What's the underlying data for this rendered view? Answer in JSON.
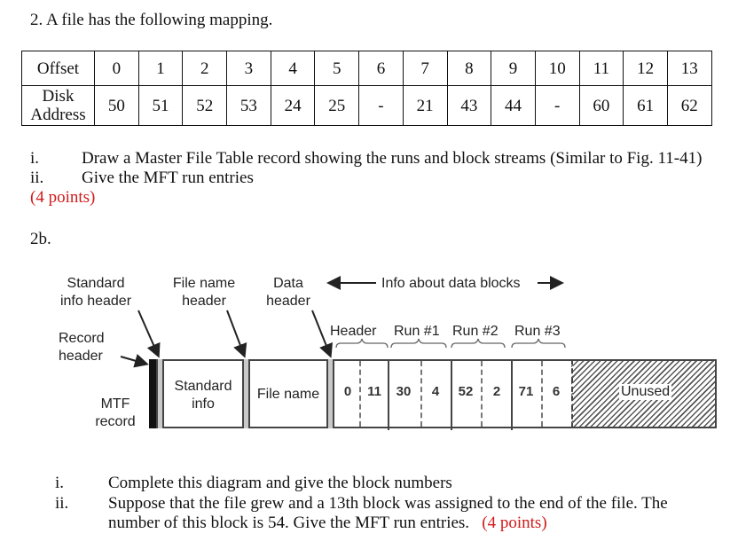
{
  "question2": {
    "title": "2.   A file has the following mapping.",
    "table": {
      "row_headers": [
        "Offset",
        "Disk Address"
      ],
      "offsets": [
        "0",
        "1",
        "2",
        "3",
        "4",
        "5",
        "6",
        "7",
        "8",
        "9",
        "10",
        "11",
        "12",
        "13"
      ],
      "disk_addresses": [
        "50",
        "51",
        "52",
        "53",
        "24",
        "25",
        "-",
        "21",
        "43",
        "44",
        "-",
        "60",
        "61",
        "62"
      ]
    },
    "items": [
      {
        "marker": "i.",
        "text": "Draw a Master File Table record showing the runs and block streams (Similar to Fig. 11-41)"
      },
      {
        "marker": "ii.",
        "text": "Give the MFT run entries"
      }
    ],
    "points": "(4 points)"
  },
  "question2b": {
    "label": "2b.",
    "diagram": {
      "labels": {
        "standard_info_header": [
          "Standard",
          "info header"
        ],
        "file_name_header": [
          "File name",
          "header"
        ],
        "data_header": [
          "Data",
          "header"
        ],
        "info_about_data_blocks": "Info about data blocks",
        "record_header": [
          "Record",
          "header"
        ],
        "mtf_record": [
          "MTF",
          "record"
        ]
      },
      "fields": {
        "standard_info": [
          "Standard",
          "info"
        ],
        "file_name": "File name",
        "unused": "Unused"
      },
      "groups": [
        "Header",
        "Run #1",
        "Run #2",
        "Run #3"
      ],
      "values": [
        {
          "group": "Header",
          "a": "0",
          "b": "11"
        },
        {
          "group": "Run #1",
          "a": "30",
          "b": "4"
        },
        {
          "group": "Run #2",
          "a": "52",
          "b": "2"
        },
        {
          "group": "Run #3",
          "a": "71",
          "b": "6"
        }
      ]
    },
    "items": [
      {
        "marker": "i.",
        "text": "Complete this diagram and give the block numbers"
      },
      {
        "marker": "ii.",
        "text_line1": "Suppose that the file grew and a 13th block was assigned to the end of the file. The",
        "text_line2": "number of this block is 54. Give the MFT run entries.",
        "points": "(4 points)"
      }
    ]
  },
  "colors": {
    "points_red": "#d11a1a",
    "text": "#111111",
    "diagram_grey": "#c9c9c9"
  }
}
